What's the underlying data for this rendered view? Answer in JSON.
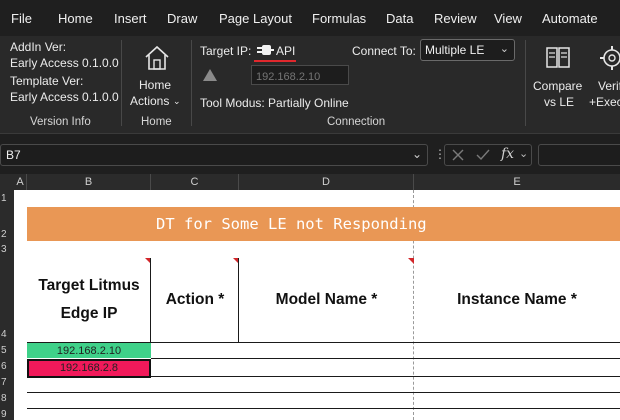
{
  "menu": [
    "File",
    "Home",
    "Insert",
    "Draw",
    "Page Layout",
    "Formulas",
    "Data",
    "Review",
    "View",
    "Automate"
  ],
  "ribbon": {
    "version_info": {
      "addin_label": "AddIn Ver:",
      "addin_value": "Early Access 0.1.0.0",
      "template_label": "Template Ver:",
      "template_value": "Early Access 0.1.0.0",
      "group_title": "Version Info"
    },
    "home": {
      "button_line1": "Home",
      "button_line2": "Actions",
      "group_title": "Home"
    },
    "connection": {
      "target_ip_label": "Target IP:",
      "api_label": "API",
      "ip_placeholder": "192.168.2.10",
      "tool_modus": "Tool Modus: Partially Online",
      "connect_to_label": "Connect To:",
      "connect_to_value": "Multiple LE",
      "group_title": "Connection"
    },
    "compare": {
      "line1": "Compare",
      "line2": "vs LE"
    },
    "verify": {
      "line1": "Verif",
      "line2": "+Exec"
    }
  },
  "formula_bar": {
    "name_box": "B7",
    "fx": "fx"
  },
  "sheet": {
    "columns": [
      "A",
      "B",
      "C",
      "D",
      "E"
    ],
    "rows": [
      "1",
      "2",
      "3",
      "4",
      "5",
      "6",
      "7",
      "8",
      "9"
    ],
    "banner": "DT for Some LE not Responding",
    "headers": {
      "target_line1": "Target Litmus",
      "target_line2": "Edge IP",
      "action": "Action *",
      "model": "Model Name *",
      "instance": "Instance Name *"
    },
    "cells": [
      "192.168.2.10",
      "192.168.2.8"
    ]
  },
  "colors": {
    "accent_red": "#e0282d",
    "banner_orange": "#e99755",
    "ok_green": "#3fd189",
    "error_red": "#f1195a"
  }
}
